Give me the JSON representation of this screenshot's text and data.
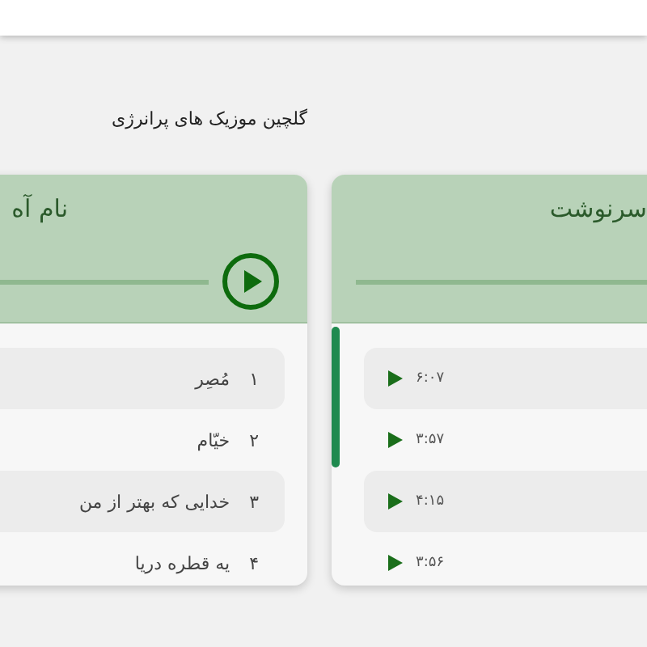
{
  "page_title": "گلچین موزیک های پرانرژی",
  "cards": [
    {
      "title": "سرنوشت",
      "tracks": [
        {
          "duration": "۶:۰۷"
        },
        {
          "duration": "۳:۵۷"
        },
        {
          "duration": "۴:۱۵"
        },
        {
          "duration": "۳:۵۶"
        }
      ]
    },
    {
      "title": "نام آه",
      "play_button": true,
      "tracks": [
        {
          "number": "۱",
          "name": "مُصِر"
        },
        {
          "number": "۲",
          "name": "خیّام"
        },
        {
          "number": "۳",
          "name": "خدایی که بهتر از من"
        },
        {
          "number": "۴",
          "name": "یه قطره دریا"
        }
      ]
    }
  ]
}
